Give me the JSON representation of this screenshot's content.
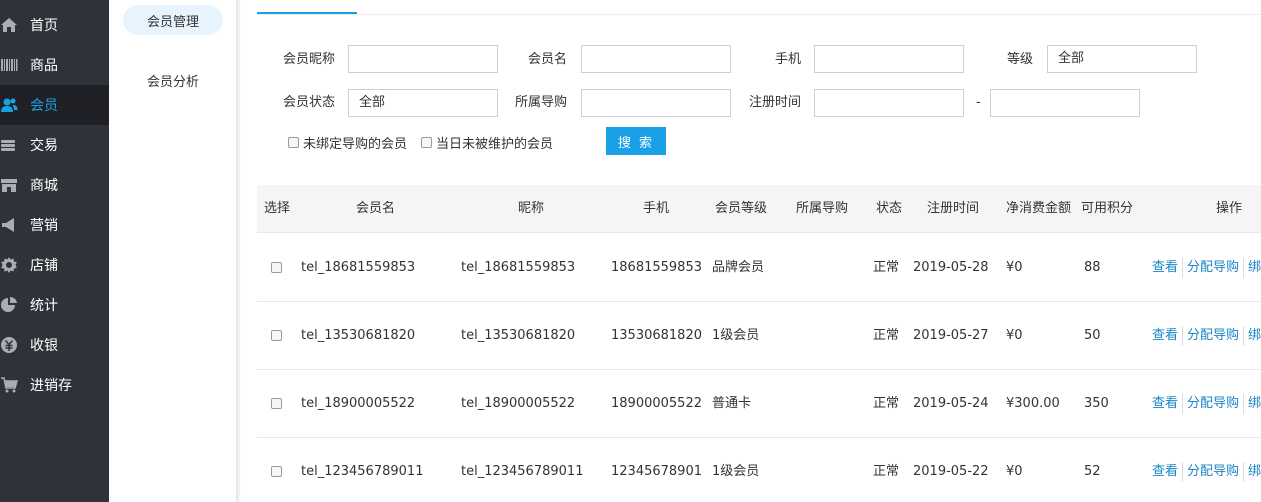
{
  "nav": [
    {
      "label": "首页",
      "icon": "home-icon"
    },
    {
      "label": "商品",
      "icon": "barcode-icon"
    },
    {
      "label": "会员",
      "icon": "users-icon",
      "active": true
    },
    {
      "label": "交易",
      "icon": "coins-icon"
    },
    {
      "label": "商城",
      "icon": "store-icon"
    },
    {
      "label": "营销",
      "icon": "megaphone-icon"
    },
    {
      "label": "店铺",
      "icon": "gear-icon"
    },
    {
      "label": "统计",
      "icon": "pie-chart-icon"
    },
    {
      "label": "收银",
      "icon": "yen-icon"
    },
    {
      "label": "进销存",
      "icon": "cart-icon"
    }
  ],
  "submenu": [
    {
      "label": "会员管理",
      "active": true
    },
    {
      "label": "会员分析"
    }
  ],
  "filters": {
    "nickname_label": "会员昵称",
    "nickname_value": "",
    "member_name_label": "会员名",
    "member_name_value": "",
    "phone_label": "手机",
    "phone_value": "",
    "level_label": "等级",
    "level_value": "全部",
    "status_label": "会员状态",
    "status_value": "全部",
    "guide_label": "所属导购",
    "guide_value": "",
    "regtime_label": "注册时间",
    "regtime_start": "",
    "regtime_sep": "-",
    "regtime_end": "",
    "unbound_guide_label": "未绑定导购的会员",
    "not_maintained_label": "当日未被维护的会员",
    "search_button": "搜 索"
  },
  "table": {
    "columns": [
      "选择",
      "会员名",
      "昵称",
      "手机",
      "会员等级",
      "所属导购",
      "状态",
      "注册时间",
      "净消费金额",
      "可用积分",
      "操作"
    ],
    "rows": [
      {
        "member_name": "tel_18681559853",
        "nickname": "tel_18681559853",
        "phone": "18681559853",
        "level": "品牌会员",
        "guide": "",
        "status": "正常",
        "reg_date": "2019-05-28",
        "net_spend": "¥0",
        "points": "88"
      },
      {
        "member_name": "tel_13530681820",
        "nickname": "tel_13530681820",
        "phone": "13530681820",
        "level": "1级会员",
        "guide": "",
        "status": "正常",
        "reg_date": "2019-05-27",
        "net_spend": "¥0",
        "points": "50"
      },
      {
        "member_name": "tel_18900005522",
        "nickname": "tel_18900005522",
        "phone": "18900005522",
        "level": "普通卡",
        "guide": "",
        "status": "正常",
        "reg_date": "2019-05-24",
        "net_spend": "¥300.00",
        "points": "350"
      },
      {
        "member_name": "tel_123456789011",
        "nickname": "tel_123456789011",
        "phone": "12345678901",
        "level": "1级会员",
        "guide": "",
        "status": "正常",
        "reg_date": "2019-05-22",
        "net_spend": "¥0",
        "points": "52"
      }
    ],
    "actions": [
      "查看",
      "分配导购",
      "绑"
    ]
  }
}
